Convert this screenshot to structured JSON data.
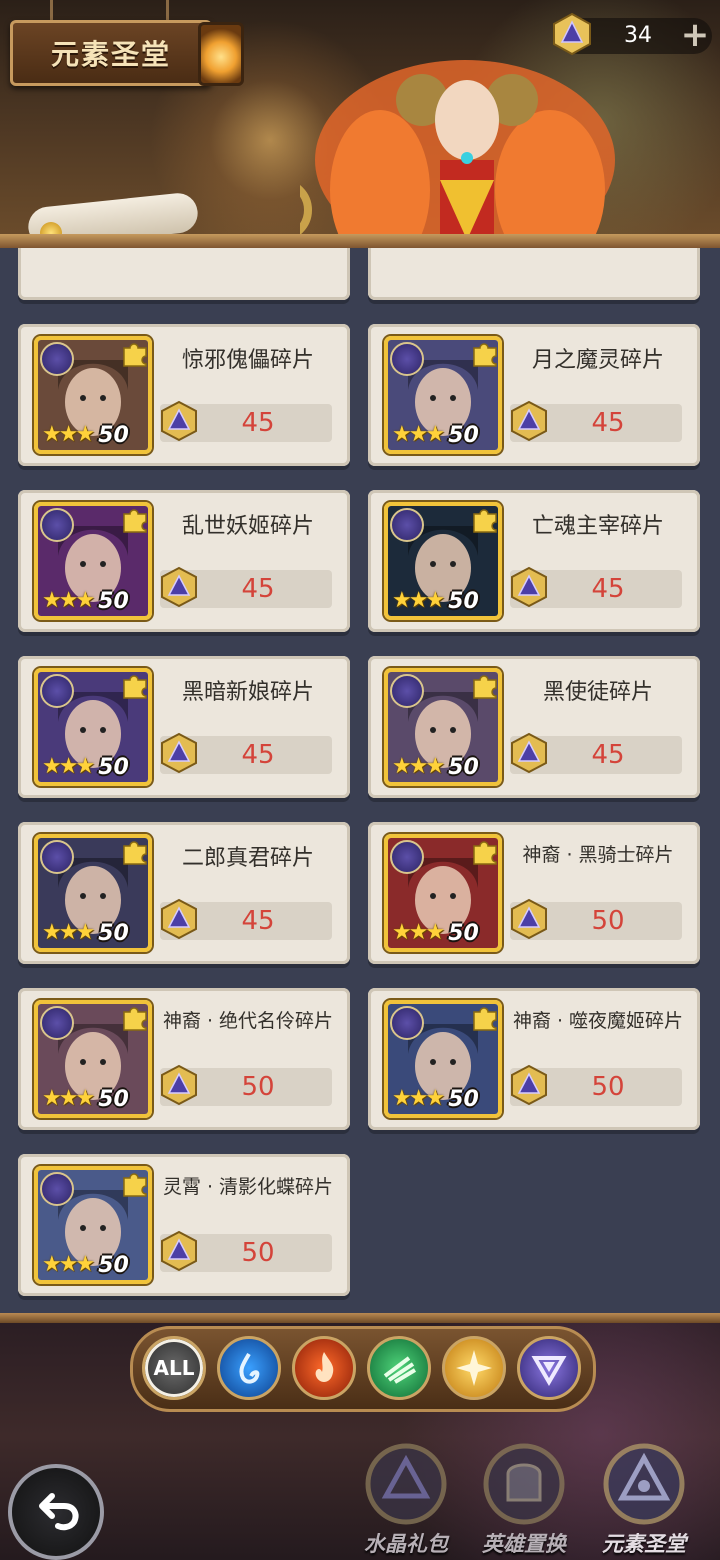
{
  "header": {
    "title": "元素圣堂",
    "currency": {
      "icon": "crystal-icon",
      "value": "34",
      "add_label": "+"
    }
  },
  "cards": [
    {
      "name": "惊邪傀儡碎片",
      "level": "50",
      "stars": 3,
      "price": "45",
      "art": "#6a4a3a"
    },
    {
      "name": "月之魔灵碎片",
      "level": "50",
      "stars": 3,
      "price": "45",
      "art": "#4a4a7a"
    },
    {
      "name": "乱世妖姬碎片",
      "level": "50",
      "stars": 3,
      "price": "45",
      "art": "#5a2a6a"
    },
    {
      "name": "亡魂主宰碎片",
      "level": "50",
      "stars": 3,
      "price": "45",
      "art": "#1c2a3a"
    },
    {
      "name": "黑暗新娘碎片",
      "level": "50",
      "stars": 3,
      "price": "45",
      "art": "#4a3a7a"
    },
    {
      "name": "黑使徒碎片",
      "level": "50",
      "stars": 3,
      "price": "45",
      "art": "#5a4a6a"
    },
    {
      "name": "二郎真君碎片",
      "level": "50",
      "stars": 3,
      "price": "45",
      "art": "#3a3a5a"
    },
    {
      "name": "神裔 · 黑骑士碎片",
      "level": "50",
      "stars": 3,
      "price": "50",
      "art": "#8a2a2a"
    },
    {
      "name": "神裔 · 绝代名伶碎片",
      "level": "50",
      "stars": 3,
      "price": "50",
      "art": "#6a4a5a"
    },
    {
      "name": "神裔 · 噬夜魔姬碎片",
      "level": "50",
      "stars": 3,
      "price": "50",
      "art": "#3a4a7a"
    },
    {
      "name": "灵霄 · 清影化蝶碎片",
      "level": "50",
      "stars": 3,
      "price": "50",
      "art": "#4a5a8a"
    }
  ],
  "filters": {
    "all_label": "ALL",
    "items": [
      "filter-all",
      "water-element",
      "fire-element",
      "wind-element",
      "light-element",
      "dark-element"
    ],
    "selected": "ALL"
  },
  "bottom_nav": {
    "items": [
      {
        "label": "水晶礼包",
        "icon": "crystal-pack-icon"
      },
      {
        "label": "英雄置换",
        "icon": "hero-swap-icon"
      },
      {
        "label": "元素圣堂",
        "icon": "element-sanctum-icon",
        "active": true
      }
    ]
  },
  "colors": {
    "price_text": "#d4443a",
    "portrait_border": "#f1c33a",
    "card_bg": "#ece6dc"
  }
}
